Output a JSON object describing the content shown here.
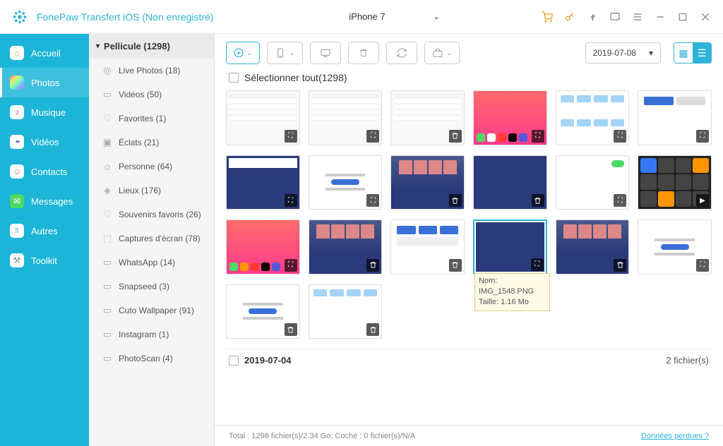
{
  "app": {
    "title": "FonePaw Transfert iOS (Non enregistré)",
    "device": "iPhone 7"
  },
  "nav": {
    "items": [
      {
        "label": "Accueil"
      },
      {
        "label": "Photos"
      },
      {
        "label": "Musique"
      },
      {
        "label": "Vidéos"
      },
      {
        "label": "Contacts"
      },
      {
        "label": "Messages"
      },
      {
        "label": "Autres"
      },
      {
        "label": "Toolkit"
      }
    ]
  },
  "albums": {
    "header": "Pellicule (1298)",
    "items": [
      {
        "label": "Live Photos (18)"
      },
      {
        "label": "Vidéos (50)"
      },
      {
        "label": "Favorites (1)"
      },
      {
        "label": "Éclats (21)"
      },
      {
        "label": "Personne (64)"
      },
      {
        "label": "Lieux (176)"
      },
      {
        "label": "Souvenirs favoris (26)"
      },
      {
        "label": "Captures d'écran (78)"
      },
      {
        "label": "WhatsApp (14)"
      },
      {
        "label": "Snapseed (3)"
      },
      {
        "label": "Cuto Wallpaper (91)"
      },
      {
        "label": "Instagram (1)"
      },
      {
        "label": "PhotoScan (4)"
      }
    ]
  },
  "toolbar": {
    "date": "2019-07-08"
  },
  "selectall": {
    "label": "Sélectionner tout(1298)"
  },
  "tooltip": {
    "name_label": "Nom:",
    "name_value": "IMG_1548.PNG",
    "size_label": "Taille:",
    "size_value": "1.16 Mo"
  },
  "section2": {
    "date": "2019-07-04",
    "count": "2 fichier(s)"
  },
  "statusbar": {
    "left": "Total : 1298 fichier(s)/2.34 Go; Coché : 0 fichier(s)/N/A",
    "right": "Données perdues ?"
  }
}
